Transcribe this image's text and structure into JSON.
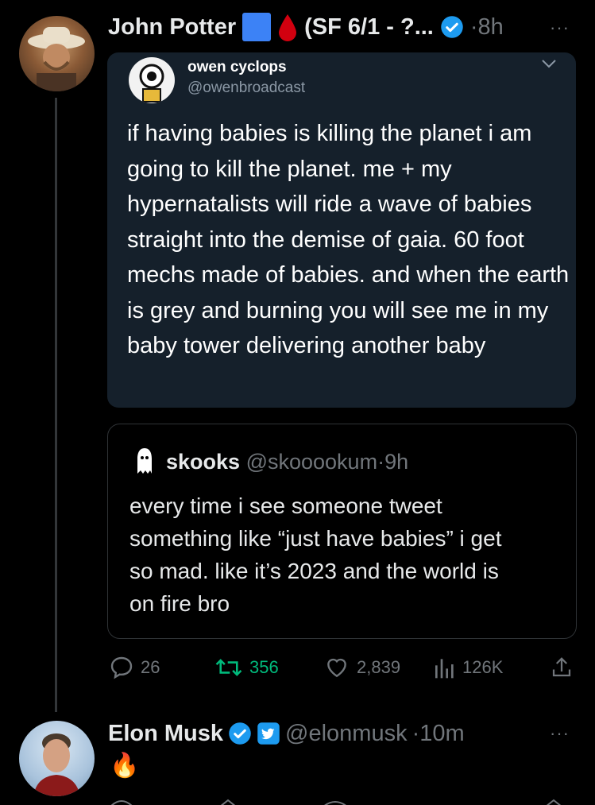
{
  "tweet1": {
    "author_name": "John Potter",
    "author_suffix": "(SF 6/1 - ?...",
    "time": "8h",
    "more_label": "···"
  },
  "embedded_image": {
    "name": "owen cyclops",
    "handle": "@owenbroadcast",
    "text": "if having babies is killing the planet i am going to kill the planet. me + my hypernatalists will ride a wave of babies straight into the demise of gaia. 60 foot mechs made of babies. and when the earth is grey and burning you will see me in my baby tower delivering another baby"
  },
  "quoted": {
    "name": "skooks",
    "handle": "@skooookum",
    "time": "9h",
    "text": "every time i see someone tweet something like “just have babies” i get so mad. like it’s 2023 and the world is on fire bro"
  },
  "actions": {
    "replies": "26",
    "reposts": "356",
    "likes": "2,839",
    "views": "126K"
  },
  "tweet2": {
    "author_name": "Elon Musk",
    "handle": "@elonmusk",
    "time": "10m",
    "text": "🔥",
    "more_label": "···"
  },
  "colors": {
    "background": "#000000",
    "muted": "#71767b",
    "verified_blue": "#1d9bf0",
    "repost_green": "#00ba7c",
    "border": "#2f3336"
  }
}
